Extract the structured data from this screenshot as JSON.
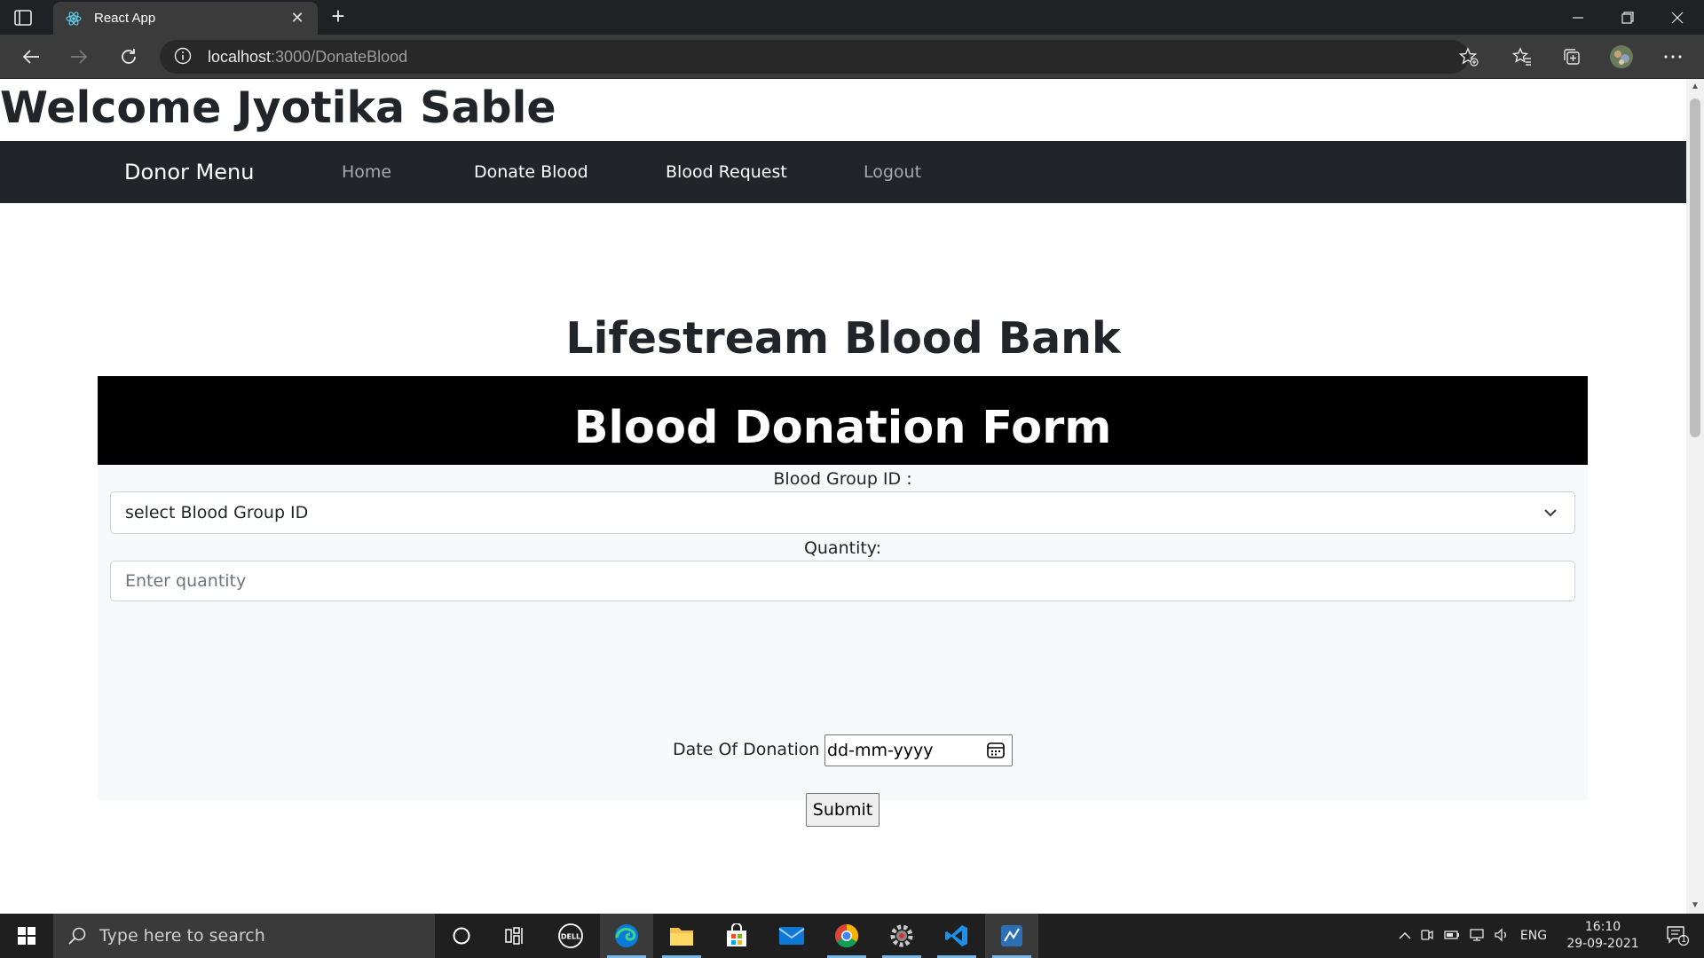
{
  "browser": {
    "tab_title": "React App",
    "url_host": "localhost",
    "url_path": ":3000/DonateBlood",
    "new_tab_glyph": "+"
  },
  "page": {
    "welcome": "Welcome Jyotika Sable",
    "navbar": {
      "brand": "Donor Menu",
      "links": [
        {
          "label": "Home"
        },
        {
          "label": "Donate Blood"
        },
        {
          "label": "Blood Request"
        },
        {
          "label": "Logout"
        }
      ]
    },
    "bank_title": "Lifestream Blood Bank",
    "form": {
      "header": "Blood Donation Form",
      "blood_group_label": "Blood Group ID :",
      "blood_group_selected": "select Blood Group ID",
      "quantity_label": "Quantity:",
      "quantity_placeholder": "Enter quantity",
      "date_label": "Date Of Donation :",
      "date_value": "dd-mm-yyyy",
      "submit_label": "Submit"
    }
  },
  "taskbar": {
    "search_placeholder": "Type here to search",
    "language": "ENG",
    "time": "16:10",
    "date": "29-09-2021",
    "notification_count": "1",
    "apps": [
      "cortana-icon",
      "task-view-icon",
      "dell-icon",
      "edge-icon",
      "file-explorer-icon",
      "store-icon",
      "mail-icon",
      "chrome-icon",
      "settings-icon",
      "vscode-icon",
      "network-app-icon"
    ]
  },
  "colors": {
    "navbar_bg": "#212529",
    "form_header_bg": "#000000",
    "form_bg": "#f8f9fa",
    "taskbar_bg": "#1f1f1f"
  }
}
